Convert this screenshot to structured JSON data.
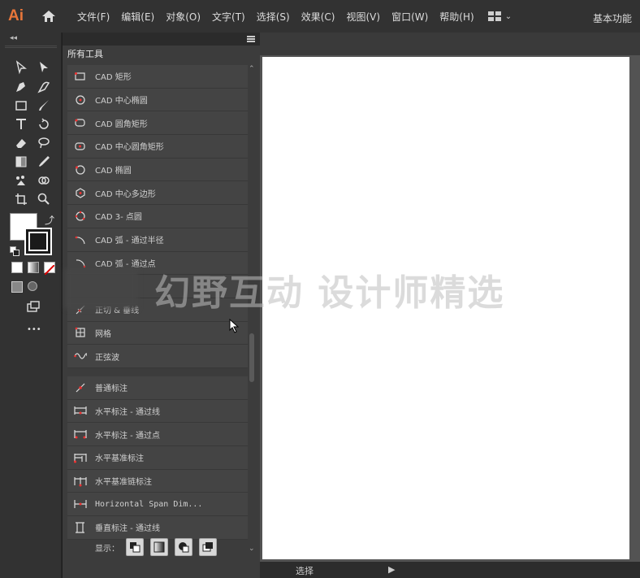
{
  "app": {
    "logo": "Ai",
    "menus": [
      "文件(F)",
      "编辑(E)",
      "对象(O)",
      "文字(T)",
      "选择(S)",
      "效果(C)",
      "视图(V)",
      "窗口(W)",
      "帮助(H)"
    ],
    "workspace": "基本功能"
  },
  "tools": {
    "collapse": "◂◂",
    "more": "•••"
  },
  "panel": {
    "title": "所有工具",
    "items": [
      {
        "label": "CAD 矩形",
        "icon": "cad-rectangle-icon"
      },
      {
        "label": "CAD 中心椭圆",
        "icon": "cad-center-ellipse-icon"
      },
      {
        "label": "CAD 圆角矩形",
        "icon": "cad-rounded-rectangle-icon"
      },
      {
        "label": "CAD 中心圆角矩形",
        "icon": "cad-center-rounded-rectangle-icon"
      },
      {
        "label": "CAD 椭圆",
        "icon": "cad-ellipse-icon"
      },
      {
        "label": "CAD 中心多边形",
        "icon": "cad-center-polygon-icon"
      },
      {
        "label": "CAD 3- 点圆",
        "icon": "cad-3-point-circle-icon"
      },
      {
        "label": "CAD 弧 - 通过半径",
        "icon": "cad-arc-radius-icon"
      },
      {
        "label": "CAD 弧 - 通过点",
        "icon": "cad-arc-points-icon"
      },
      {
        "label": "",
        "icon": "blurred-icon"
      },
      {
        "label": "正切 & 垂线",
        "icon": "tangent-perpendicular-icon"
      },
      {
        "label": "网格",
        "icon": "grid-icon"
      },
      {
        "label": "正弦波",
        "icon": "sine-wave-icon"
      },
      {
        "label": "普通标注",
        "icon": "normal-dimension-icon"
      },
      {
        "label": "水平标注 - 通过线",
        "icon": "horizontal-dimension-line-icon"
      },
      {
        "label": "水平标注 - 通过点",
        "icon": "horizontal-dimension-point-icon"
      },
      {
        "label": "水平基准标注",
        "icon": "horizontal-baseline-dimension-icon"
      },
      {
        "label": "水平基准链标注",
        "icon": "horizontal-baseline-chain-dimension-icon"
      },
      {
        "label": "Horizontal Span Dim...",
        "icon": "horizontal-span-dimension-icon"
      },
      {
        "label": "垂直标注 - 通过线",
        "icon": "vertical-dimension-line-icon"
      }
    ],
    "footer_label": "显示："
  },
  "status": {
    "mode": "选择",
    "arrow": "▶"
  },
  "watermark": "幻野互动 设计师精选"
}
